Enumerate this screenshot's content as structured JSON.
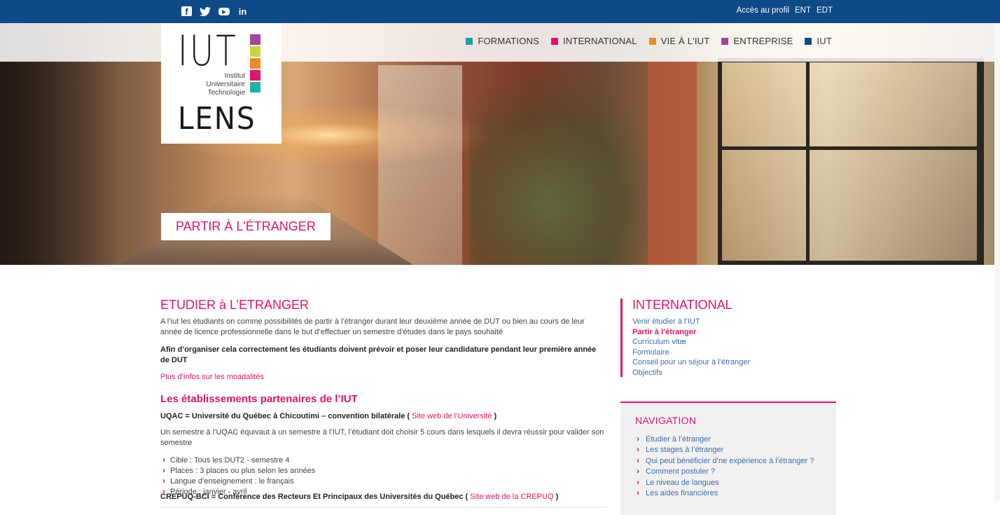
{
  "topbar": {
    "social": [
      "facebook-icon",
      "twitter-icon",
      "youtube-icon",
      "linkedin-icon"
    ],
    "links": [
      "Accès au profil",
      "ENT",
      "EDT"
    ]
  },
  "colors": {
    "topbar": "#0e4a86",
    "accent": "#e3126a",
    "link": "#3a6fb0",
    "formations": "#1ba2a0",
    "international": "#e3126a",
    "vie": "#f08a24",
    "entreprise": "#a4449c",
    "iut": "#0e4a86"
  },
  "nav": [
    {
      "label": "FORMATIONS",
      "color": "#1ba2a0"
    },
    {
      "label": "INTERNATIONAL",
      "color": "#e3126a"
    },
    {
      "label": "VIE À L'IUT",
      "color": "#f08a24"
    },
    {
      "label": "ENTREPRISE",
      "color": "#a4449c"
    },
    {
      "label": "IUT",
      "color": "#0e4a86"
    }
  ],
  "logo": {
    "top": "IUT",
    "line1": "Institut",
    "line2": "Universitaire",
    "line3": "Technologie",
    "bottom": "LENS",
    "squares": [
      "#a4449c",
      "#c8d63a",
      "#f08a24",
      "#e3126a",
      "#1bb6a6"
    ]
  },
  "hero": {
    "label": "PARTIR À L'ÉTRANGER"
  },
  "content": {
    "title": "ETUDIER à L’ETRANGER",
    "intro": "A l’iut les étudiants on comme possibilités de partir à l’étranger durant leur deuxième année de DUT ou bien au cours de leur année de licence professionnelle dans le but d’effectuer un semestre d’études dans le pays souhaité",
    "bold_note": "Afin d’organiser cela correctement les étudiants doivent prévoir et poser leur candidature pendant leur première année de DUT",
    "more_link": "Plus d’infos sur les moadalités",
    "partners_title": "Les établissements partenaires de l’IUT",
    "uqac": {
      "name": "UQAC = Université du Québec à Chicoutimi – convention bilatérale (",
      "link": "Site web de l’Université",
      "close": ")",
      "desc": "Un semestre à l’UQAC équivaut à un semestre à l’IUT, l’étudiant doit choisir 5 cours dans lesquels il devra réussir pour valider son semestre",
      "bullets": [
        "Cible : Tous les DUT2 - semestre 4",
        "Places : 3 places ou plus selon les années",
        "Langue d’enseignement : le français",
        "Période : janvier - avril"
      ]
    },
    "crepuq": {
      "name": "CREPUQ-BCI = Conférence des Recteurs Et Principaux des Universités du Québec (",
      "link": "Site web de la CREPUQ",
      "close": ")"
    }
  },
  "sidebar": {
    "international_title": "INTERNATIONAL",
    "international_links": [
      {
        "label": "Venir étudier à l’IUT",
        "active": false
      },
      {
        "label": "Partir à l’étranger",
        "active": true
      },
      {
        "label": "Curriculum vitæ",
        "active": false
      },
      {
        "label": "Formulaire",
        "active": false
      },
      {
        "label": "Conseil pour un séjour à l’étranger",
        "active": false
      },
      {
        "label": "Objectifs",
        "active": false
      }
    ],
    "navigation_title": "NAVIGATION",
    "navigation_links": [
      "Etudier à l’étranger",
      "Les stages à l’étranger",
      "Qui peut bénéficier d’ne expérience à l’étranger ?",
      "Comment postuler ?",
      "Le niveau de langues",
      "Les aides financières"
    ]
  }
}
